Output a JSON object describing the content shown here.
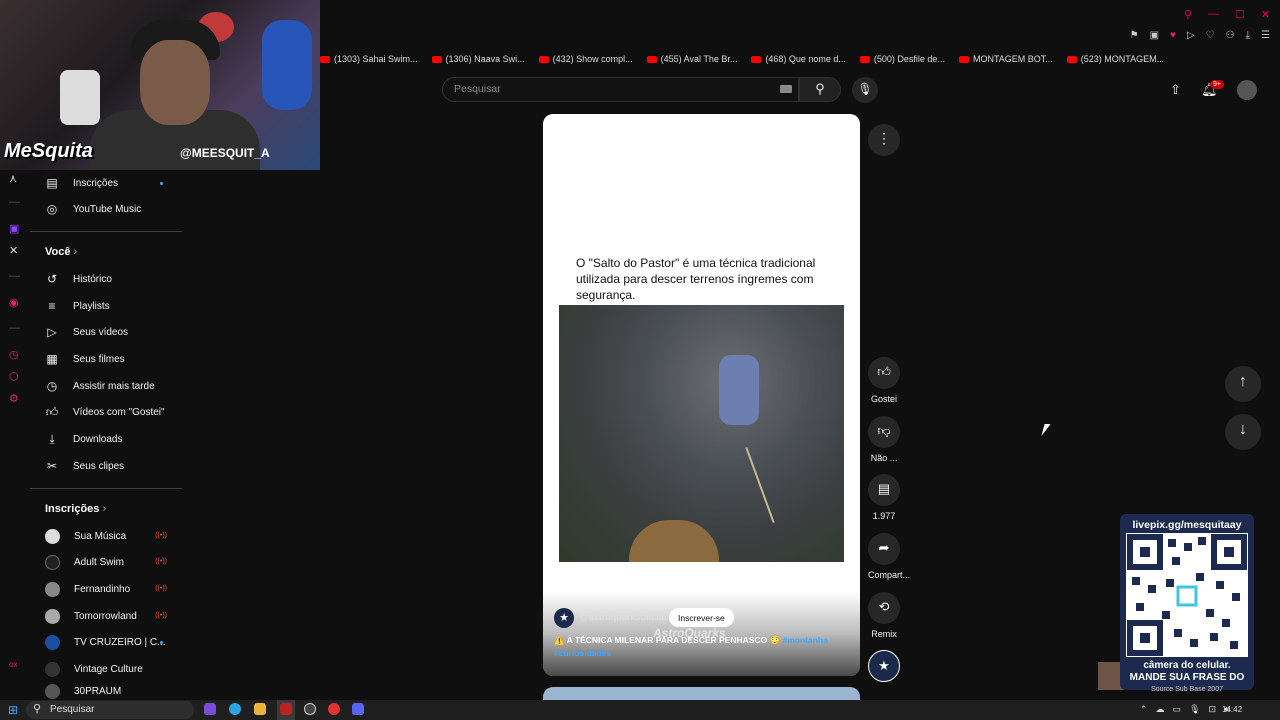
{
  "browser": {
    "bookmarks": [
      "(1303) Sahai Swim...",
      "(1306) Naava Swi...",
      "(432) Show compl...",
      "(455) Aval The Br...",
      "(468) Que nome d...",
      "(500) Desfile de...",
      "MONTAGEM BOT...",
      "(523) MONTAGEM..."
    ]
  },
  "webcam": {
    "name": "MeSquita",
    "handle": "@MEESQUIT_A"
  },
  "header": {
    "search_placeholder": "Pesquisar",
    "notification_count": "9+"
  },
  "sidebar": {
    "top_items": [
      {
        "label": "Inscrições",
        "icon": "subscriptions-icon"
      },
      {
        "label": "YouTube Music",
        "icon": "music-icon"
      }
    ],
    "you_header": "Você",
    "you_items": [
      {
        "label": "Histórico",
        "icon": "history-icon"
      },
      {
        "label": "Playlists",
        "icon": "playlists-icon"
      },
      {
        "label": "Seus vídeos",
        "icon": "your-videos-icon"
      },
      {
        "label": "Seus filmes",
        "icon": "movies-icon"
      },
      {
        "label": "Assistir mais tarde",
        "icon": "watch-later-icon"
      },
      {
        "label": "Vídeos com \"Gostei\"",
        "icon": "like-icon"
      },
      {
        "label": "Downloads",
        "icon": "download-icon"
      },
      {
        "label": "Seus clipes",
        "icon": "clips-icon"
      }
    ],
    "subs_header": "Inscrições",
    "subscriptions": [
      {
        "label": "Sua Música",
        "status": "live"
      },
      {
        "label": "Adult Swim",
        "status": "live"
      },
      {
        "label": "Fernandinho",
        "status": "live"
      },
      {
        "label": "Tomorrowland",
        "status": "live"
      },
      {
        "label": "TV CRUZEIRO | C...",
        "status": "new"
      },
      {
        "label": "Vintage Culture",
        "status": ""
      },
      {
        "label": "30PRAUM",
        "status": ""
      }
    ]
  },
  "short": {
    "caption": "O \"Salto do Pastor\" é uma técnica tradicional utilizada para descer terrenos íngremes com segurança.",
    "channel": "@astroquarksoficial",
    "subscribe_label": "Inscrever-se",
    "watermark": "AstroQuarks",
    "description": "⚠️ A TÉCNICA MILENAR PARA DESCER PENHASCO 😳 ",
    "hashtags": "#montanha #curiosidades"
  },
  "actions": {
    "like": "Gostei",
    "dislike": "Não ...",
    "comments": "1.977",
    "share": "Compart...",
    "remix": "Remix"
  },
  "overlay": {
    "qr_title": "livepix.gg/mesquitaay",
    "qr_sub_line1": "câmera do celular.",
    "qr_sub_line2": "MANDE SUA FRASE DO",
    "qr_sub_small": "Source Sub Base 2007"
  },
  "taskbar": {
    "search_label": "Pesquisar",
    "time": "14:42"
  }
}
